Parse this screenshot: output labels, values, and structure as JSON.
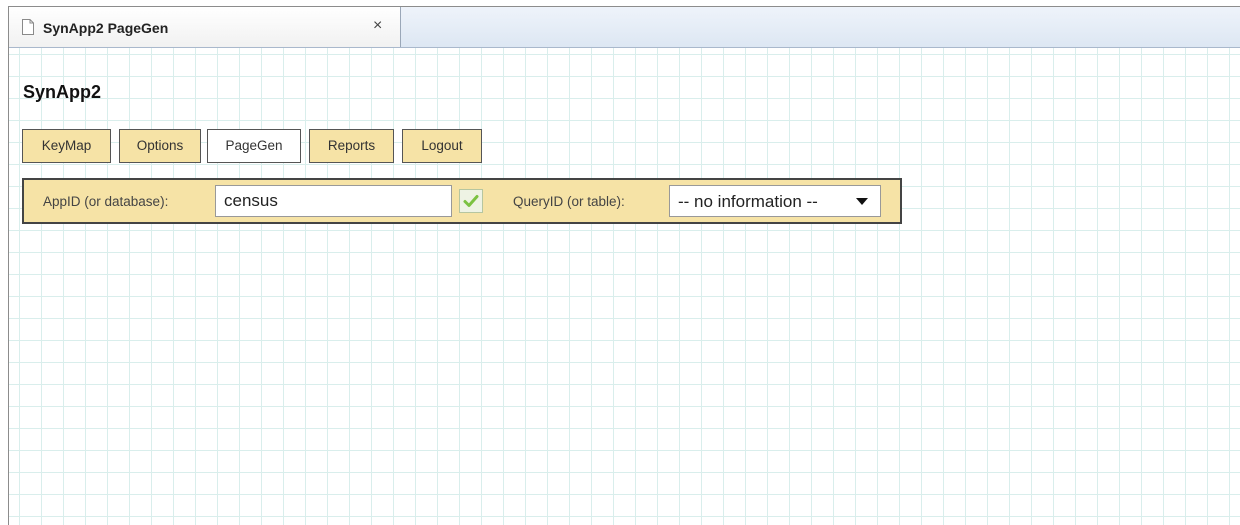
{
  "tab": {
    "title": "SynApp2 PageGen",
    "close_label": "×",
    "doc_icon": "document-icon"
  },
  "app": {
    "title": "SynApp2"
  },
  "nav": {
    "items": [
      {
        "label": "KeyMap",
        "active": false
      },
      {
        "label": "Options",
        "active": false
      },
      {
        "label": "PageGen",
        "active": true
      },
      {
        "label": "Reports",
        "active": false
      },
      {
        "label": "Logout",
        "active": false
      }
    ]
  },
  "toolbar": {
    "app_label": "AppID (or database):",
    "app_value": "census",
    "check_icon": "checkmark-icon",
    "query_label": "QueryID (or table):",
    "query_selected": "-- no information --",
    "dropdown_icon": "dropdown-arrow-icon"
  },
  "colors": {
    "panel_bg": "#f6e3a6",
    "grid_line": "#d9eeec",
    "check_green": "#7cc242"
  }
}
